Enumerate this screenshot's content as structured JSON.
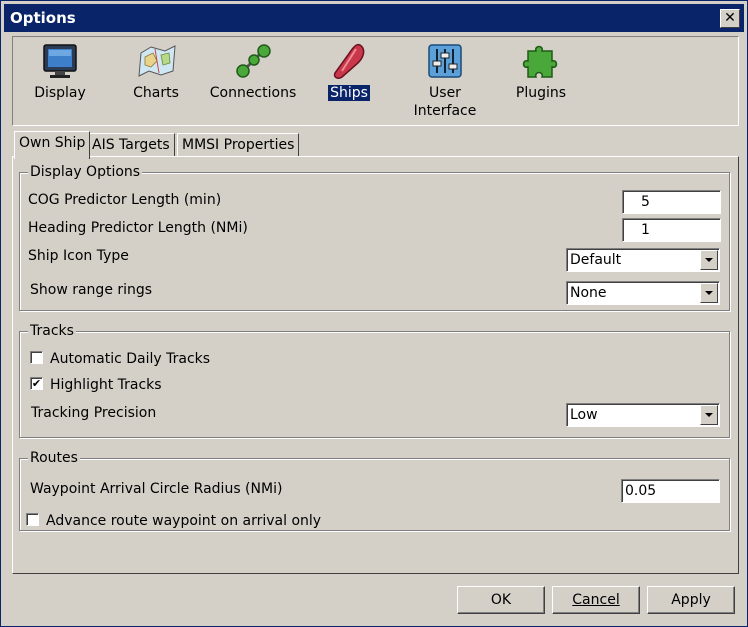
{
  "window": {
    "title": "Options",
    "close_glyph": "✕"
  },
  "toolbar": {
    "items": [
      {
        "label": "Display",
        "icon": "monitor-icon",
        "selected": false
      },
      {
        "label": "Charts",
        "icon": "chart-map-icon",
        "selected": false
      },
      {
        "label": "Connections",
        "icon": "connections-icon",
        "selected": false
      },
      {
        "label": "Ships",
        "icon": "ship-icon",
        "selected": true
      },
      {
        "label": "User Interface",
        "label_line1": "User",
        "label_line2": "Interface",
        "icon": "sliders-icon",
        "selected": false
      },
      {
        "label": "Plugins",
        "icon": "puzzle-icon",
        "selected": false
      }
    ]
  },
  "tabs": [
    {
      "label": "Own Ship",
      "active": true
    },
    {
      "label": "AIS Targets",
      "active": false
    },
    {
      "label": "MMSI Properties",
      "active": false
    }
  ],
  "display_options": {
    "title": "Display Options",
    "cog_label": "COG Predictor Length (min)",
    "cog_value": "5",
    "heading_label": "Heading Predictor Length (NMi)",
    "heading_value": "1",
    "icon_type_label": "Ship Icon Type",
    "icon_type_value": "Default",
    "range_rings_label": "Show range rings",
    "range_rings_value": "None"
  },
  "tracks": {
    "title": "Tracks",
    "auto_daily_label": "Automatic Daily Tracks",
    "auto_daily_checked": false,
    "highlight_label": "Highlight Tracks",
    "highlight_checked": true,
    "check_glyph": "✔",
    "precision_label": "Tracking Precision",
    "precision_value": "Low"
  },
  "routes": {
    "title": "Routes",
    "radius_label": "Waypoint Arrival Circle Radius (NMi)",
    "radius_value": "0.05",
    "advance_label": "Advance route waypoint on arrival only",
    "advance_checked": false
  },
  "buttons": {
    "ok": "OK",
    "cancel": "Cancel",
    "apply": "Apply"
  },
  "colors": {
    "face": "#d4d0c8",
    "titlebar": "#0a246a",
    "selection": "#0a246a"
  }
}
